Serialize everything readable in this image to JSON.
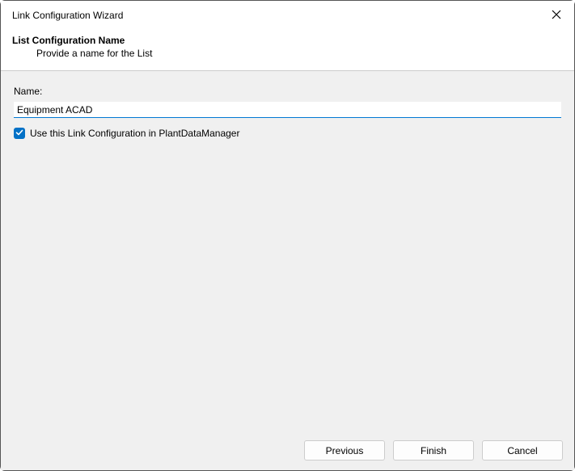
{
  "window": {
    "title": "Link Configuration Wizard"
  },
  "header": {
    "title": "List Configuration Name",
    "subtitle": "Provide a name for the List"
  },
  "form": {
    "name_label": "Name:",
    "name_value": "Equipment ACAD",
    "checkbox_label": "Use this Link Configuration in PlantDataManager",
    "checkbox_checked": true
  },
  "buttons": {
    "previous": "Previous",
    "finish": "Finish",
    "cancel": "Cancel"
  }
}
